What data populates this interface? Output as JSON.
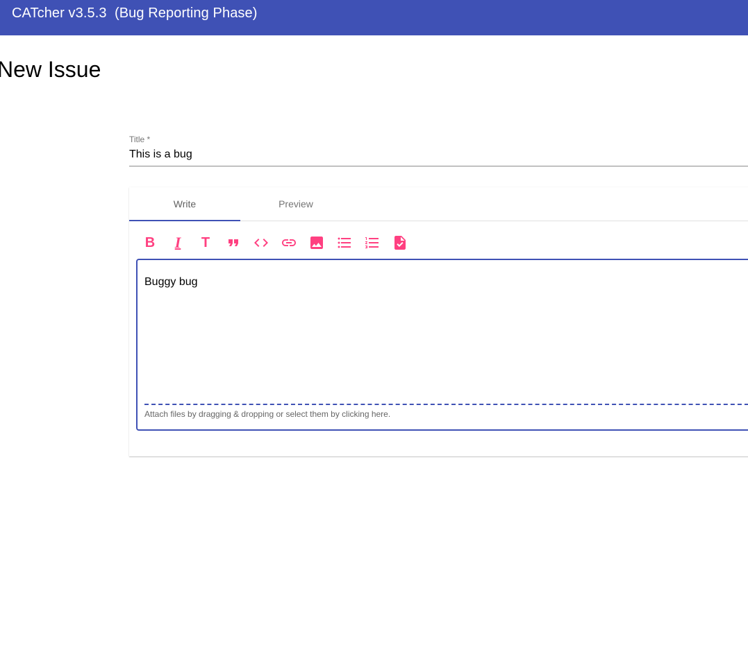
{
  "app": {
    "title": "CATcher v3.5.3  (Bug Reporting Phase)",
    "accent_color": "#3f51b5",
    "icon_color": "#ff4081"
  },
  "page": {
    "title": "New Issue"
  },
  "title_field": {
    "label": "Title *",
    "value": "This is a bug"
  },
  "tabs": [
    {
      "label": "Write",
      "active": true
    },
    {
      "label": "Preview",
      "active": false
    }
  ],
  "markdown_toolbar": [
    {
      "icon": "bold-icon",
      "glyph": "B"
    },
    {
      "icon": "italic-icon",
      "glyph": "I"
    },
    {
      "icon": "heading-icon",
      "glyph": "T"
    },
    {
      "icon": "quote-icon"
    },
    {
      "icon": "code-icon"
    },
    {
      "icon": "link-icon"
    },
    {
      "icon": "image-icon"
    },
    {
      "icon": "bulleted-list-icon"
    },
    {
      "icon": "numbered-list-icon"
    },
    {
      "icon": "task-list-icon"
    }
  ],
  "editor": {
    "value": "Buggy bug",
    "attach_hint": "Attach files by dragging & dropping or select them by clicking here."
  }
}
